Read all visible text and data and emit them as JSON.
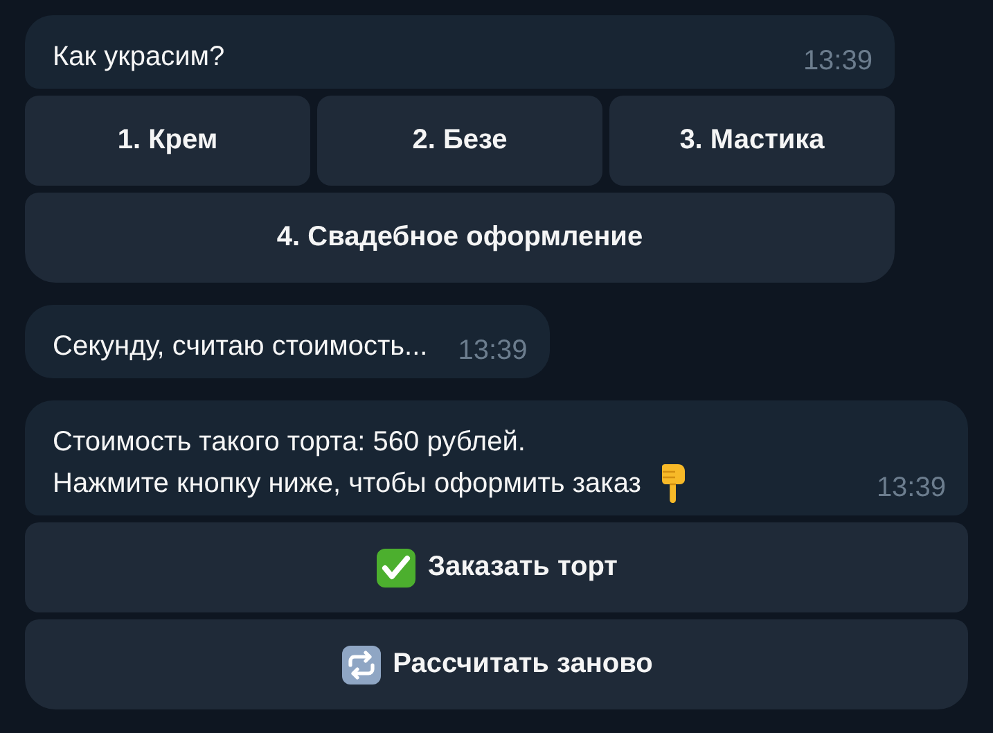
{
  "messages": [
    {
      "kind": "plain",
      "lines": [
        "Как украсим?"
      ],
      "time": "13:39",
      "keyboard": {
        "kind": "grid",
        "rows": [
          {
            "buttons": [
              {
                "label": "1. Крем",
                "kind": "plain"
              },
              {
                "label": "2. Безе",
                "kind": "plain"
              },
              {
                "label": "3. Мастика",
                "kind": "plain"
              }
            ]
          },
          {
            "buttons": [
              {
                "label": "4. Свадебное оформление",
                "kind": "plain"
              }
            ]
          }
        ]
      }
    },
    {
      "kind": "plain",
      "lines": [
        "Секунду, считаю стоимость..."
      ],
      "time": "13:39"
    },
    {
      "kind": "pointer",
      "lines": [
        "Стоимость такого торта: 560 рублей.",
        "Нажмите кнопку ниже, чтобы оформить заказ"
      ],
      "time": "13:39",
      "keyboard": {
        "kind": "stack",
        "rows": [
          {
            "buttons": [
              {
                "label": "Заказать торт",
                "kind": "confirm"
              }
            ]
          },
          {
            "buttons": [
              {
                "label": "Рассчитать заново",
                "kind": "repeat"
              }
            ]
          }
        ]
      }
    }
  ]
}
